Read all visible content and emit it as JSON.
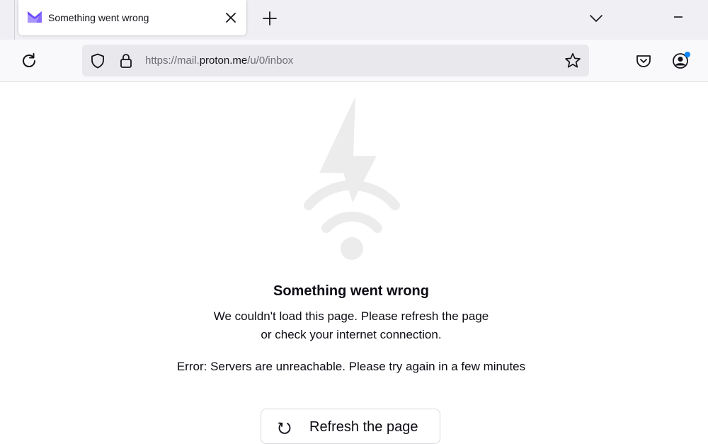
{
  "browser": {
    "tab": {
      "title": "Something went wrong",
      "favicon": "proton-mail-icon"
    },
    "url": {
      "prefix": "https://mail.",
      "domain": "proton.me",
      "path": "/u/0/inbox"
    }
  },
  "error": {
    "title": "Something went wrong",
    "message": "We couldn't load this page. Please refresh the page or check your internet connection.",
    "detail": "Error: Servers are unreachable. Please try again in a few minutes",
    "refresh_label": "Refresh the page"
  },
  "colors": {
    "accent": "#6d4aff",
    "notification_dot": "#0a84ff",
    "illustration": "#ececec"
  }
}
